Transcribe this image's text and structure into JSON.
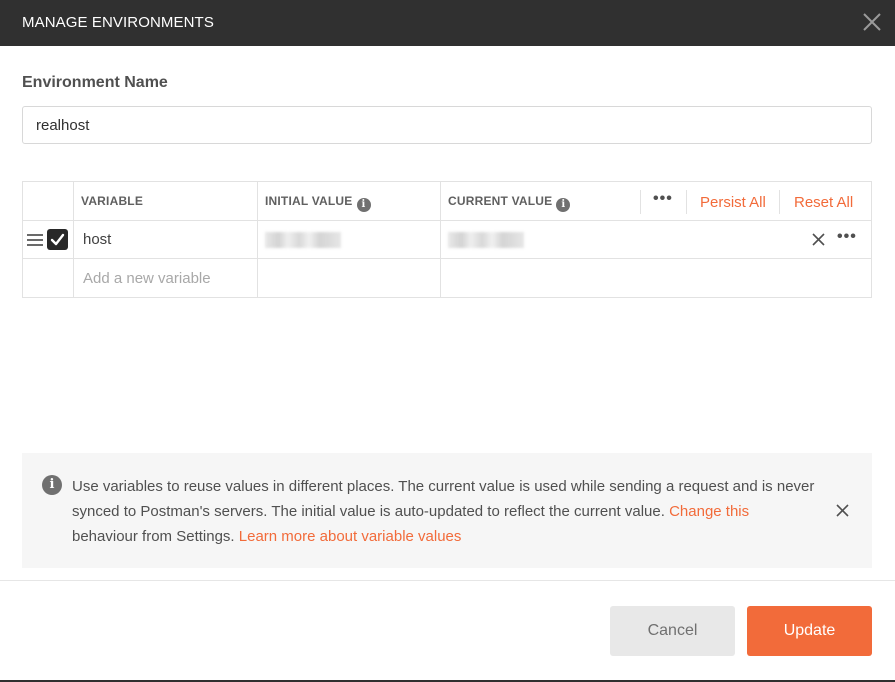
{
  "dialog": {
    "title": "MANAGE ENVIRONMENTS",
    "close_icon": "close-icon"
  },
  "environment": {
    "label": "Environment Name",
    "value": "realhost"
  },
  "table": {
    "headers": {
      "variable": "VARIABLE",
      "initial_value": "INITIAL VALUE",
      "current_value": "CURRENT VALUE"
    },
    "info_glyph": "i",
    "more_glyph": "•••",
    "persist_all": "Persist All",
    "reset_all": "Reset All",
    "rows": [
      {
        "enabled": true,
        "variable": "host",
        "initial_value_redacted": true,
        "current_value_redacted": true
      }
    ],
    "new_variable_placeholder": "Add a new variable"
  },
  "banner": {
    "info_glyph": "i",
    "text": "Use variables to reuse values in different places. The current value is used while sending a request and is never synced to Postman's servers. The initial value is auto-updated to reflect the current value. ",
    "change_link": "Change this",
    "text_after": " behaviour from Settings. ",
    "learn_more_link": "Learn more about variable values"
  },
  "footer": {
    "cancel_label": "Cancel",
    "update_label": "Update"
  },
  "colors": {
    "titlebar": "#303030",
    "accent": "#f26b3a",
    "banner_bg": "#f6f6f6"
  }
}
